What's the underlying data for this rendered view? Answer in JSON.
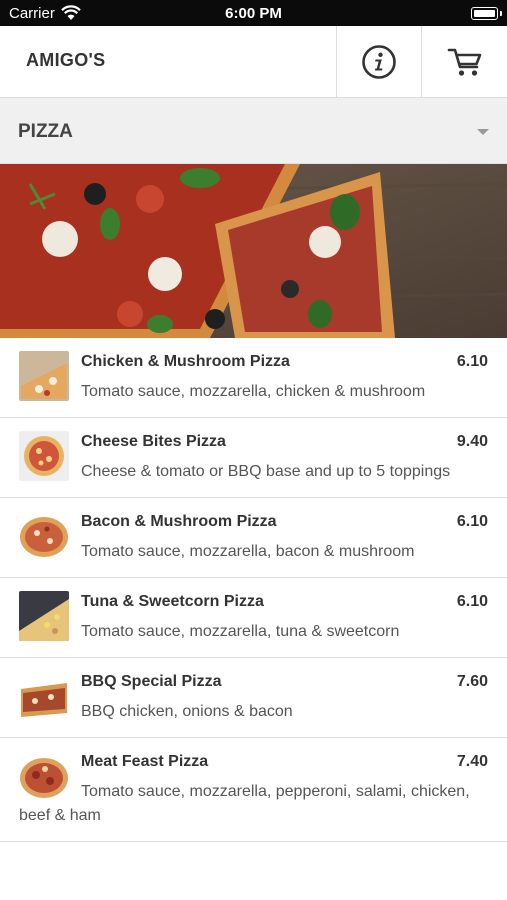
{
  "status_bar": {
    "carrier": "Carrier",
    "time": "6:00 PM"
  },
  "header": {
    "title": "AMIGO'S",
    "info_icon": "info-icon",
    "cart_icon": "cart-icon"
  },
  "category": {
    "selected": "PIZZA"
  },
  "menu": {
    "items": [
      {
        "name": "Chicken & Mushroom Pizza",
        "price": "6.10",
        "description": "Tomato sauce, mozzarella, chicken & mushroom"
      },
      {
        "name": "Cheese Bites Pizza",
        "price": "9.40",
        "description": "Cheese & tomato or BBQ base and up to 5 toppings"
      },
      {
        "name": "Bacon & Mushroom Pizza",
        "price": "6.10",
        "description": "Tomato sauce, mozzarella, bacon & mushroom"
      },
      {
        "name": "Tuna & Sweetcorn Pizza",
        "price": "6.10",
        "description": "Tomato sauce, mozzarella, tuna & sweetcorn"
      },
      {
        "name": "BBQ Special Pizza",
        "price": "7.60",
        "description": "BBQ chicken, onions & bacon"
      },
      {
        "name": "Meat Feast Pizza",
        "price": "7.40",
        "description": "Tomato sauce, mozzarella, pepperoni, salami, chicken, beef & ham"
      }
    ]
  }
}
